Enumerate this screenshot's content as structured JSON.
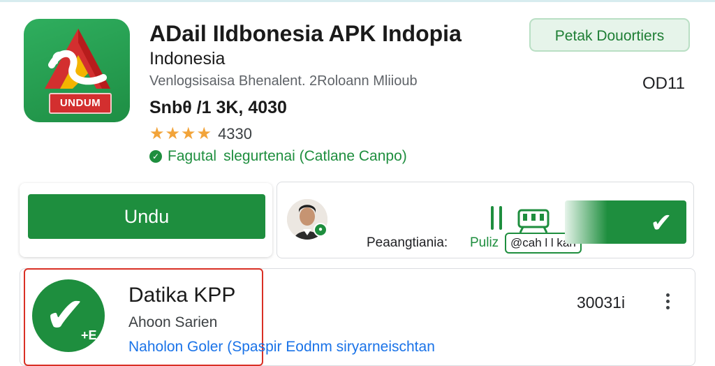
{
  "app": {
    "title": "ADail IIdbonesia APK Indopia",
    "subtitle": "Indonesia",
    "developer_line": "Venlogsisaisa  Bhenalent.  2Roloann Mliioub",
    "size_line": "Snbθ /1 3K, 4030",
    "stars": "★★★★",
    "rating_count": "4330",
    "verified_text": "Fagutal  slegurtenai (Catlane Canpo)",
    "icon_label": "UNDUM"
  },
  "top_right": {
    "button_label": "Petak Douortiers",
    "count": "OD11"
  },
  "download": {
    "button_label": "Undu"
  },
  "review": {
    "label": "Peaangtiania:",
    "link": "Puliz",
    "tag": "@cah l l kan"
  },
  "lower_item": {
    "title": "Datika KPP",
    "subtitle": "Ahoon Sarien",
    "link": "Naholon Goler  (Spaspir Eodnm siryarneischtan",
    "count": "30031i",
    "icon_corner": "+E"
  },
  "colors": {
    "brand_green": "#1e8e3e",
    "star": "#f2a43a",
    "highlight_red": "#d93025",
    "link_blue": "#1a73e8"
  },
  "icons": [
    "app-logo-icon",
    "verified-check-icon",
    "avatar",
    "vehicle-icon",
    "checkmark-icon",
    "more-vert-icon"
  ]
}
